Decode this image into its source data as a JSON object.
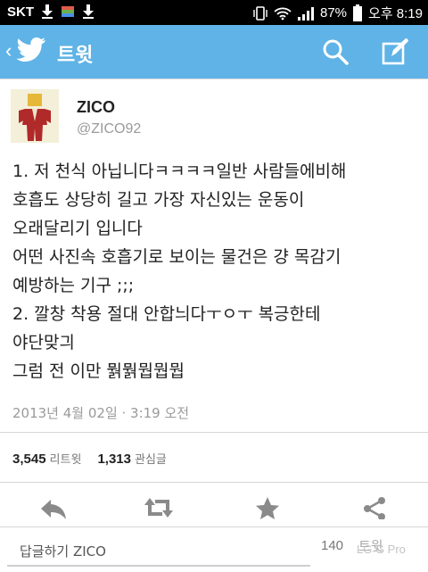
{
  "status_bar": {
    "carrier": "SKT",
    "battery": "87%",
    "time": "오후 8:19"
  },
  "app_bar": {
    "back": "‹",
    "title": "트윗"
  },
  "tweet": {
    "name": "ZICO",
    "handle": "@ZICO92",
    "lines": [
      "1. 저 천식 아닙니다ㅋㅋㅋㅋ일반 사람들에비해",
      "호흡도 상당히 길고 가장 자신있는 운동이",
      "오래달리기 입니다",
      "어떤 사진속 호흡기로 보이는 물건은 걍 목감기",
      "예방하는 기구 ;;;",
      "2. 깔창 착용 절대 안합늬다ㅜㅇㅜ 복긍한테",
      "야단맞긔",
      "그럼 전 이만 뭙뭙뭡뭡뭡"
    ],
    "date": "2013년 4월 02일 · 3:19 오전"
  },
  "stats": {
    "retweets": "3,545",
    "retweets_label": "리트윗",
    "favorites": "1,313",
    "favorites_label": "관심글"
  },
  "reply": {
    "placeholder": "답글하기 ZICO",
    "char_count": "140",
    "tweet_button": "트윗"
  },
  "watermark": "LG G Pro",
  "colors": {
    "app_bar": "#5fb3e6",
    "accent": "#3d9fdc"
  }
}
